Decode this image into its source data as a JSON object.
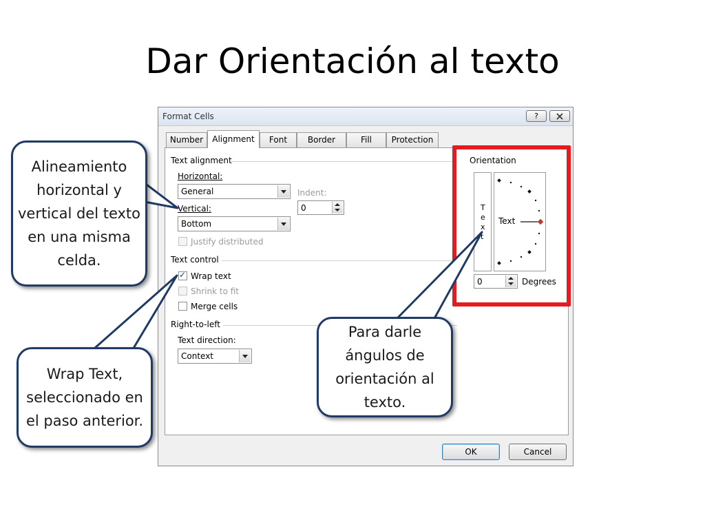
{
  "slide": {
    "title": "Dar Orientación al texto"
  },
  "dialog": {
    "title": "Format Cells",
    "help_label": "?",
    "close_label": "X",
    "tabs": [
      {
        "label": "Number"
      },
      {
        "label": "Alignment"
      },
      {
        "label": "Font"
      },
      {
        "label": "Border"
      },
      {
        "label": "Fill"
      },
      {
        "label": "Protection"
      }
    ],
    "text_alignment": {
      "group_title": "Text alignment",
      "horizontal_label": "Horizontal:",
      "horizontal_value": "General",
      "indent_label": "Indent:",
      "indent_value": "0",
      "vertical_label": "Vertical:",
      "vertical_value": "Bottom",
      "justify_distributed_label": "Justify distributed"
    },
    "text_control": {
      "group_title": "Text control",
      "wrap_text_label": "Wrap text",
      "wrap_text_checked": true,
      "shrink_to_fit_label": "Shrink to fit",
      "merge_cells_label": "Merge cells"
    },
    "right_to_left": {
      "group_title": "Right-to-left",
      "text_direction_label": "Text direction:",
      "text_direction_value": "Context"
    },
    "orientation": {
      "group_title": "Orientation",
      "vertical_text": [
        "T",
        "e",
        "x",
        "t"
      ],
      "dial_text": "Text",
      "degrees_value": "0",
      "degrees_label": "Degrees"
    },
    "ok_label": "OK",
    "cancel_label": "Cancel"
  },
  "callouts": {
    "alignment": "Alineamiento horizontal y vertical del texto en una misma celda.",
    "wrap_text": "Wrap Text, seleccionado en el paso anterior.",
    "orientation": "Para darle ángulos de orientación al texto."
  },
  "colors": {
    "highlight": "#e51b22",
    "callout_border": "#1f3a64",
    "dial_marker": "#c0392b"
  }
}
